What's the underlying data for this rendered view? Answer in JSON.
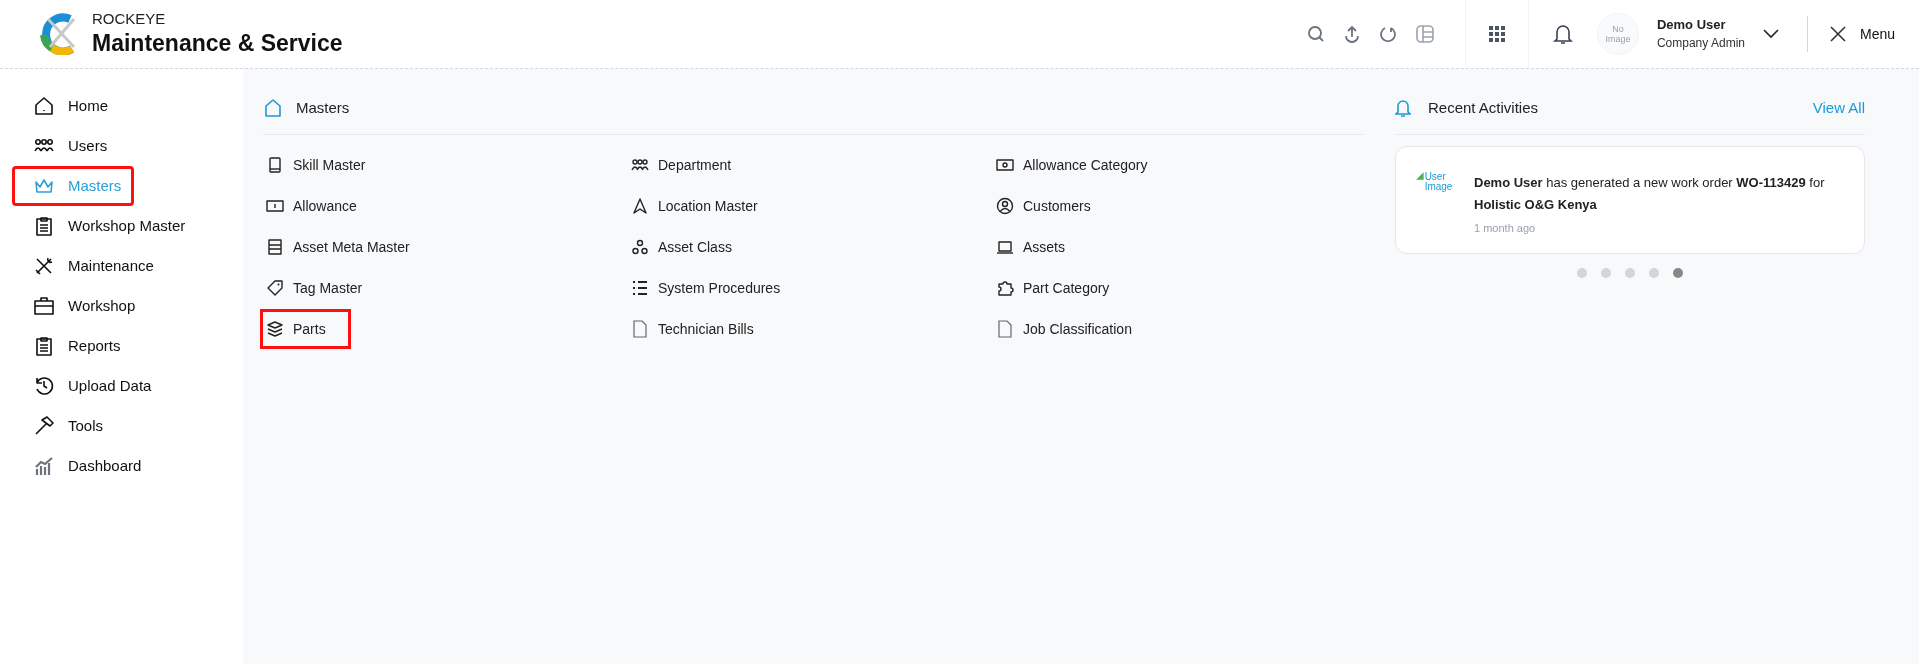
{
  "header": {
    "brand": "ROCKEYE",
    "title": "Maintenance & Service",
    "user": {
      "avatar_text": "No Image",
      "name": "Demo User",
      "role": "Company Admin"
    },
    "menu_label": "Menu"
  },
  "sidebar": {
    "items": [
      {
        "label": "Home",
        "selected": false,
        "highlighted": false
      },
      {
        "label": "Users",
        "selected": false,
        "highlighted": false
      },
      {
        "label": "Masters",
        "selected": true,
        "highlighted": true
      },
      {
        "label": "Workshop Master",
        "selected": false,
        "highlighted": false
      },
      {
        "label": "Maintenance",
        "selected": false,
        "highlighted": false
      },
      {
        "label": "Workshop",
        "selected": false,
        "highlighted": false
      },
      {
        "label": "Reports",
        "selected": false,
        "highlighted": false
      },
      {
        "label": "Upload Data",
        "selected": false,
        "highlighted": false
      },
      {
        "label": "Tools",
        "selected": false,
        "highlighted": false
      },
      {
        "label": "Dashboard",
        "selected": false,
        "highlighted": false
      }
    ]
  },
  "masters": {
    "title": "Masters",
    "columns": [
      [
        {
          "label": "Skill Master",
          "highlighted": false
        },
        {
          "label": "Allowance",
          "highlighted": false
        },
        {
          "label": "Asset Meta Master",
          "highlighted": false
        },
        {
          "label": "Tag Master",
          "highlighted": false
        },
        {
          "label": "Parts",
          "highlighted": true
        }
      ],
      [
        {
          "label": "Department",
          "highlighted": false
        },
        {
          "label": "Location Master",
          "highlighted": false
        },
        {
          "label": "Asset Class",
          "highlighted": false
        },
        {
          "label": "System Procedures",
          "highlighted": false
        },
        {
          "label": "Technician Bills",
          "highlighted": false
        }
      ],
      [
        {
          "label": "Allowance Category",
          "highlighted": false
        },
        {
          "label": "Customers",
          "highlighted": false
        },
        {
          "label": "Assets",
          "highlighted": false
        },
        {
          "label": "Part Category",
          "highlighted": false
        },
        {
          "label": "Job Classification",
          "highlighted": false
        }
      ]
    ]
  },
  "recent_activities": {
    "title": "Recent Activities",
    "view_all": "View All",
    "activity": {
      "image_alt": "User Image",
      "text": "**Demo User** has generated a new work order **WO-113429** for **Holistic O&G Kenya**",
      "time": "1 month ago"
    },
    "dots": [
      {
        "selected": false
      },
      {
        "selected": false
      },
      {
        "selected": false
      },
      {
        "selected": false
      },
      {
        "selected": true
      }
    ]
  }
}
